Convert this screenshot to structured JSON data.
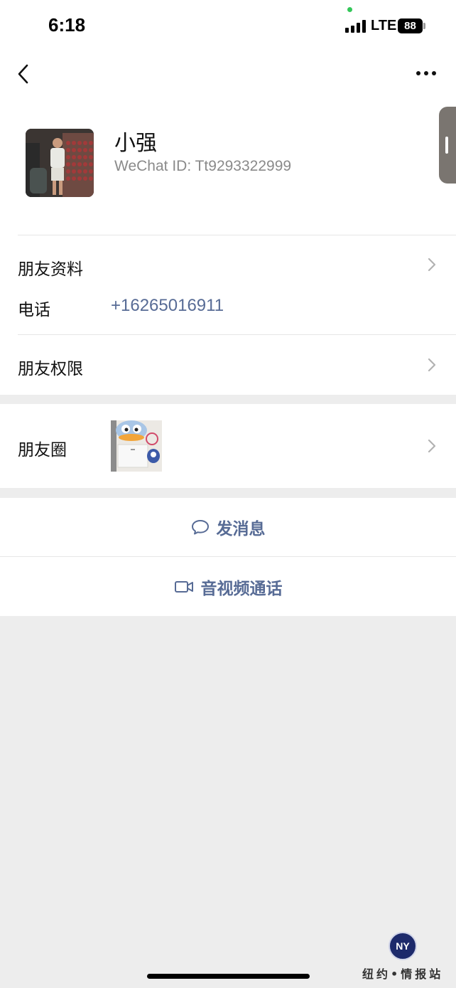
{
  "status_bar": {
    "time": "6:18",
    "network": "LTE",
    "battery": "88"
  },
  "nav": {
    "back_icon": "chevron-left-icon",
    "more_icon": "more-dots-icon"
  },
  "profile": {
    "name": "小强",
    "wechat_id": "WeChat ID: Tt9293322999"
  },
  "rows": {
    "friend_profile": "朋友资料",
    "phone_label": "电话",
    "phone_value": "+16265016911",
    "friend_permissions": "朋友权限",
    "moments": "朋友圈"
  },
  "actions": {
    "send_message": "发消息",
    "video_call": "音视频通话"
  },
  "watermark": {
    "logo_text": "NY",
    "text": "纽约•情报站"
  },
  "colors": {
    "link_blue": "#576b95",
    "background_gray": "#ededed",
    "white": "#ffffff"
  }
}
